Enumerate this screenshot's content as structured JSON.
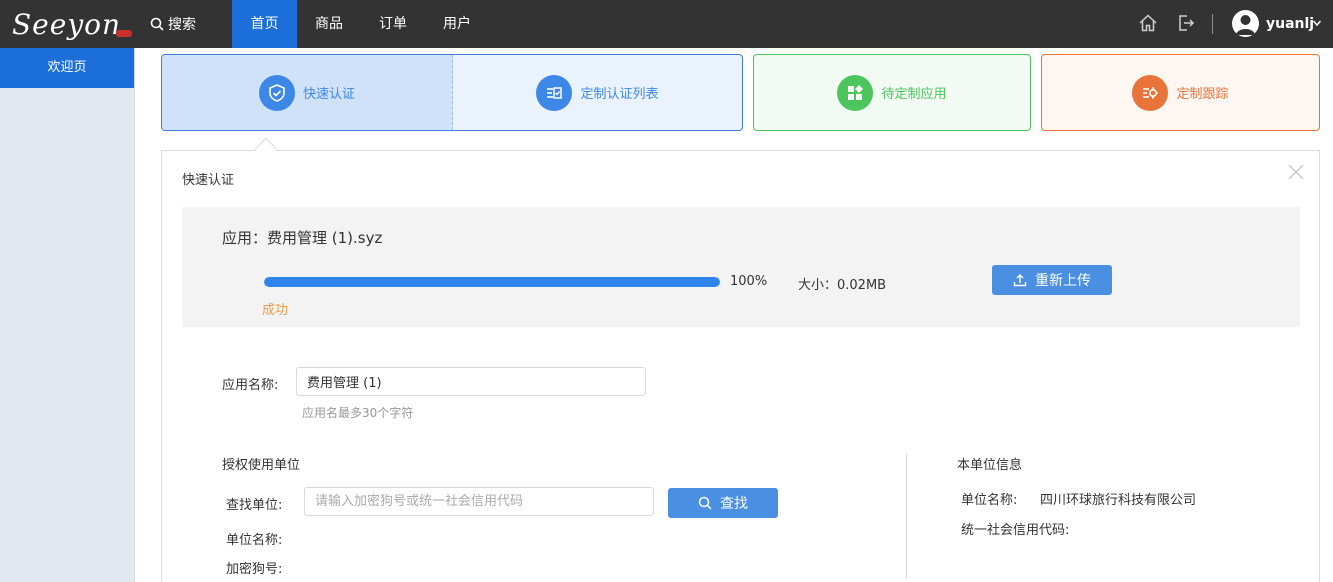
{
  "header": {
    "logo_text": "Seeyon",
    "search_label": "搜索",
    "nav": [
      "首页",
      "商品",
      "订单",
      "用户"
    ],
    "active_nav": "首页",
    "username": "yuanlj",
    "icons": [
      "home-icon",
      "logout-icon",
      "avatar-icon",
      "chevron-down-icon"
    ]
  },
  "sidebar": {
    "items": [
      {
        "label": "欢迎页",
        "active": true
      }
    ]
  },
  "steps": [
    {
      "label": "快速认证",
      "icon": "shield-icon",
      "color": "#3d87e6"
    },
    {
      "label": "定制认证列表",
      "icon": "list-icon",
      "color": "#3d87e6"
    },
    {
      "label": "待定制应用",
      "icon": "apps-icon",
      "color": "#4cc55d"
    },
    {
      "label": "定制跟踪",
      "icon": "track-icon",
      "color": "#e8743a"
    }
  ],
  "panel": {
    "title": "快速认证",
    "upload": {
      "app_label": "应用：费用管理 (1).syz",
      "progress": 100,
      "progress_text": "100%",
      "size_text": "大小：0.02MB",
      "status": "成功",
      "reupload_label": "重新上传"
    },
    "app_name": {
      "label": "应用名称:",
      "value": "费用管理 (1)",
      "hint": "应用名最多30个字符"
    },
    "auth_unit": {
      "title": "授权使用单位",
      "find_label": "查找单位:",
      "find_placeholder": "请输入加密狗号或统一社会信用代码",
      "find_button": "查找",
      "unit_name_label": "单位名称:",
      "dongle_label": "加密狗号:"
    },
    "own_unit": {
      "title": "本单位信息",
      "unit_name_label": "单位名称:",
      "unit_name_value": "四川环球旅行科技有限公司",
      "credit_code_label": "统一社会信用代码:"
    }
  },
  "colors": {
    "topbar": "#333333",
    "primary": "#1c6fd9",
    "button": "#4a8fe2",
    "success_text": "#f09a45"
  }
}
